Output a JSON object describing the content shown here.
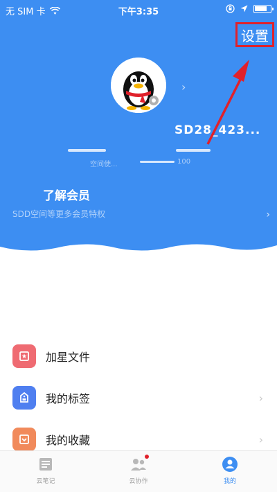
{
  "status_bar": {
    "carrier": "无 SIM 卡",
    "time": "下午3:35",
    "battery_level": 0.7
  },
  "header": {
    "settings_label": "设置",
    "username": "SD28_423...",
    "vip_title": "了解会员",
    "vip_subtitle": "SDD空间等更多会员特权",
    "blurred_text_1": "空间使...",
    "blurred_text_2": "100"
  },
  "menu": [
    {
      "label": "加星文件",
      "icon": "star-file-icon",
      "color": "#ef6b72"
    },
    {
      "label": "我的标签",
      "icon": "tag-icon",
      "color": "#4f7ff0"
    },
    {
      "label": "我的收藏",
      "icon": "favorite-icon",
      "color": "#f18a5b"
    }
  ],
  "tabbar": {
    "tabs": [
      {
        "label": "云笔记",
        "icon": "notebook-icon",
        "active": false
      },
      {
        "label": "云协作",
        "icon": "collaboration-icon",
        "active": false,
        "badge": true
      },
      {
        "label": "我的",
        "icon": "profile-icon",
        "active": true
      }
    ],
    "active_color": "#3d8ef2"
  },
  "colors": {
    "primary": "#3d8ef2",
    "annotation_red": "#e0212b"
  }
}
